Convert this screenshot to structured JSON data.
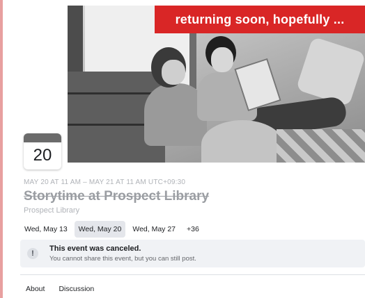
{
  "banner": {
    "text": "returning soon, hopefully ..."
  },
  "event": {
    "date_tile_day": "20",
    "date_range": "MAY 20 AT 11 AM – MAY 21 AT 11 AM UTC+09:30",
    "title": "Storytime at Prospect Library",
    "host": "Prospect Library"
  },
  "date_tabs": [
    {
      "label": "Wed, May 13"
    },
    {
      "label": "Wed, May 20"
    },
    {
      "label": "Wed, May 27"
    },
    {
      "label": "+36"
    }
  ],
  "notice": {
    "icon": "warning-icon",
    "heading": "This event was canceled.",
    "message": "You cannot share this event, but you can still post."
  },
  "nav_tabs": [
    {
      "label": "About"
    },
    {
      "label": "Discussion"
    }
  ],
  "colors": {
    "banner": "#d92626",
    "active_tab": "#e4e6eb",
    "notice_bg": "#f0f2f5"
  }
}
